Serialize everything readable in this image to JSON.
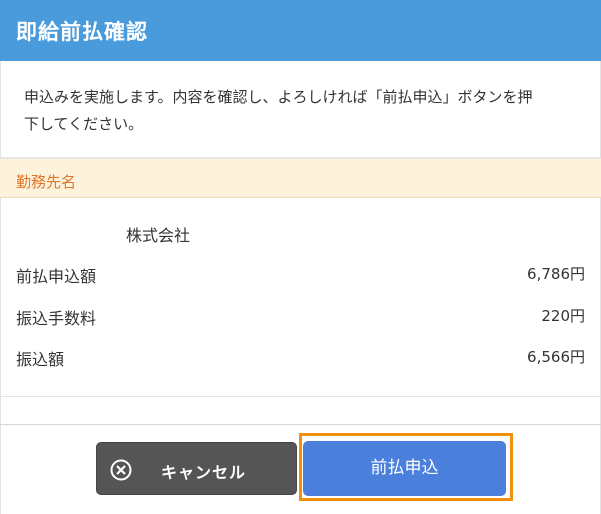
{
  "dialog": {
    "title": "即給前払確認",
    "message_line1": "申込みを実施します。内容を確認し、よろしければ「前払申込」ボタンを押",
    "message_line2": "下してください。"
  },
  "employer_section": {
    "header": "勤務先名",
    "company_name": "株式会社"
  },
  "details": [
    {
      "label": "前払申込額",
      "value": "6,786円"
    },
    {
      "label": "振込手数料",
      "value": "220円"
    },
    {
      "label": "振込額",
      "value": "6,566円"
    }
  ],
  "actions": {
    "cancel_label": "キャンセル",
    "submit_label": "前払申込"
  },
  "colors": {
    "header_bg": "#4a9bdc",
    "section_header_bg": "#fdf3dc",
    "section_header_text": "#e0762a",
    "cancel_bg": "#555555",
    "submit_bg": "#4a7fdc",
    "focus_ring": "#f0900f"
  },
  "icons": {
    "cancel": "close-circle-icon"
  }
}
